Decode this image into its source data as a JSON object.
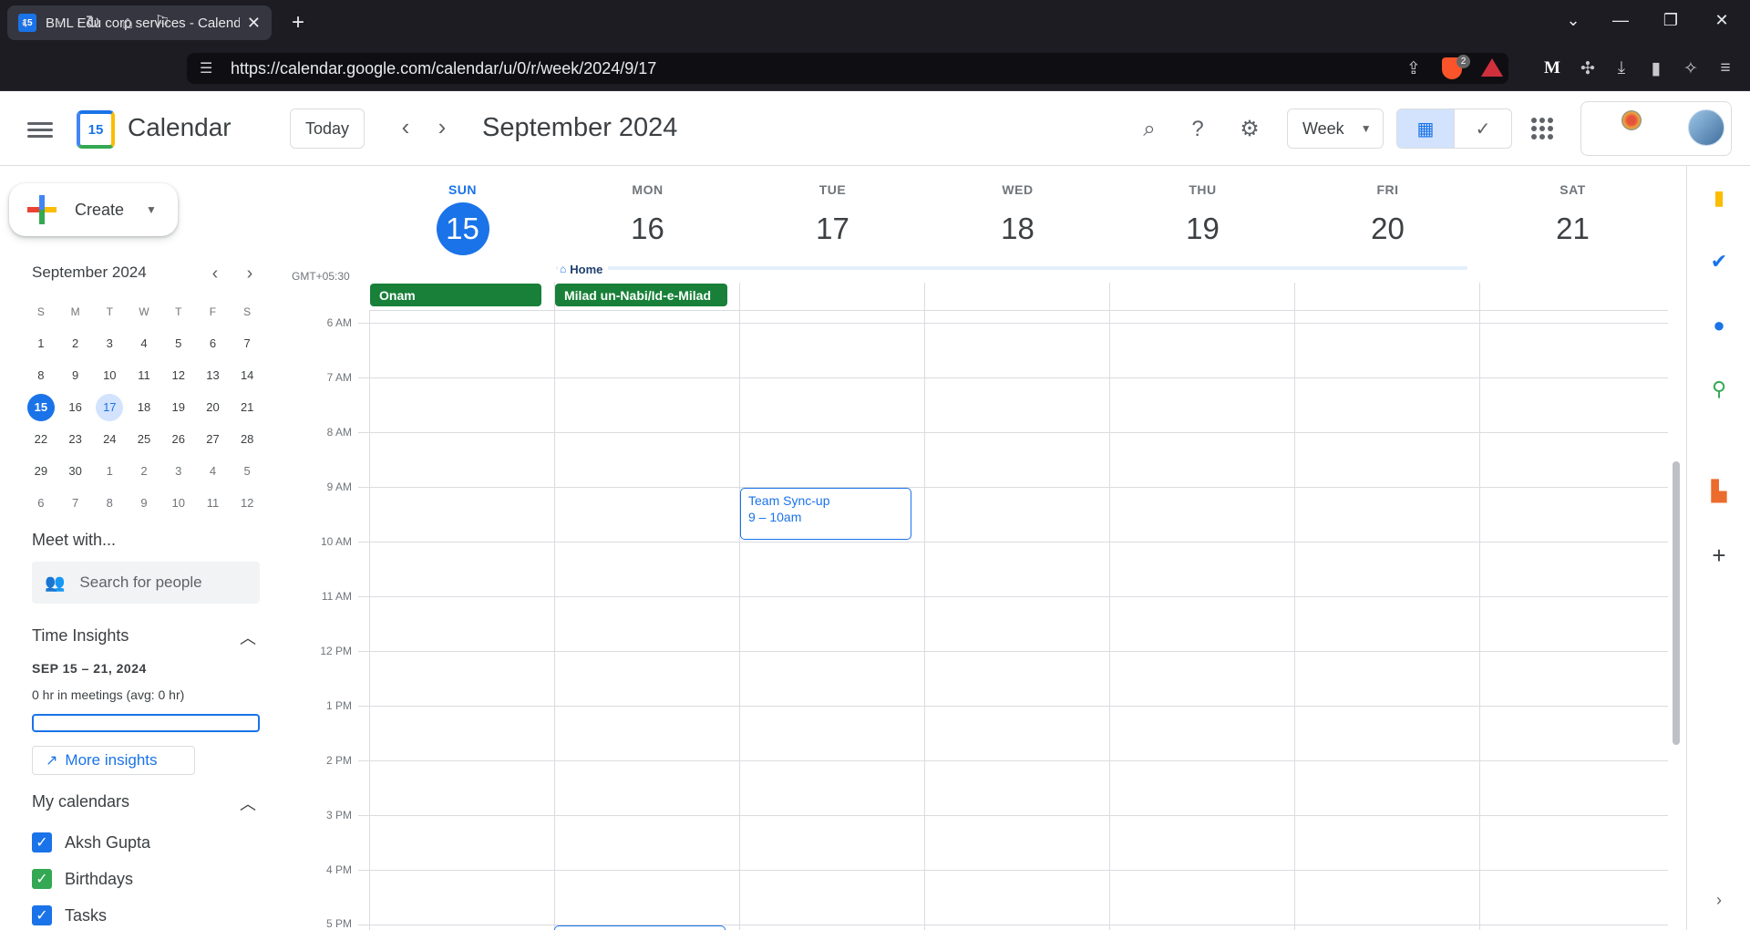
{
  "browser": {
    "tab_title": "BML Edu corp services - Calend",
    "tab_favicon_text": "15",
    "new_tab": "+",
    "url": "https://calendar.google.com/calendar/u/0/r/week/2024/9/17",
    "brave_badge": "2"
  },
  "header": {
    "app_title": "Calendar",
    "logo_text": "15",
    "today_label": "Today",
    "month_title": "September 2024",
    "view_select": "Week"
  },
  "sidebar": {
    "create_label": "Create",
    "mini_month_title": "September 2024",
    "weekday_heads": [
      "S",
      "M",
      "T",
      "W",
      "T",
      "F",
      "S"
    ],
    "weeks": [
      [
        "1",
        "2",
        "3",
        "4",
        "5",
        "6",
        "7"
      ],
      [
        "8",
        "9",
        "10",
        "11",
        "12",
        "13",
        "14"
      ],
      [
        "15",
        "16",
        "17",
        "18",
        "19",
        "20",
        "21"
      ],
      [
        "22",
        "23",
        "24",
        "25",
        "26",
        "27",
        "28"
      ],
      [
        "29",
        "30",
        "1",
        "2",
        "3",
        "4",
        "5"
      ],
      [
        "6",
        "7",
        "8",
        "9",
        "10",
        "11",
        "12"
      ]
    ],
    "meet_with": "Meet with...",
    "search_people_placeholder": "Search for people",
    "time_insights": {
      "title": "Time Insights",
      "range": "SEP 15 – 21, 2024",
      "meetings": "0 hr in meetings (avg: 0 hr)",
      "more_label": "More insights"
    },
    "my_calendars": {
      "title": "My calendars",
      "items": [
        {
          "name": "Aksh Gupta",
          "color": "#1a73e8"
        },
        {
          "name": "Birthdays",
          "color": "#34a853"
        },
        {
          "name": "Tasks",
          "color": "#1a73e8"
        }
      ]
    }
  },
  "week": {
    "timezone": "GMT+05:30",
    "days": [
      {
        "name": "SUN",
        "date": "15",
        "today": true
      },
      {
        "name": "MON",
        "date": "16"
      },
      {
        "name": "TUE",
        "date": "17"
      },
      {
        "name": "WED",
        "date": "18"
      },
      {
        "name": "THU",
        "date": "19"
      },
      {
        "name": "FRI",
        "date": "20"
      },
      {
        "name": "SAT",
        "date": "21"
      }
    ],
    "working_location": "Home",
    "all_day_events": [
      {
        "title": "Onam",
        "day": "SUN",
        "color": "#188038"
      },
      {
        "title": "Milad un-Nabi/Id-e-Milad",
        "day": "MON",
        "color": "#188038"
      }
    ],
    "hours": [
      "6 AM",
      "7 AM",
      "8 AM",
      "9 AM",
      "10 AM",
      "11 AM",
      "12 PM",
      "1 PM",
      "2 PM",
      "3 PM",
      "4 PM",
      "5 PM"
    ],
    "events": [
      {
        "title": "Team Sync-up",
        "time": "9 – 10am",
        "day": "TUE",
        "color": "#1a73e8"
      }
    ]
  },
  "colors": {
    "accent": "#1a73e8",
    "holiday": "#188038",
    "grid": "#dadce0"
  }
}
